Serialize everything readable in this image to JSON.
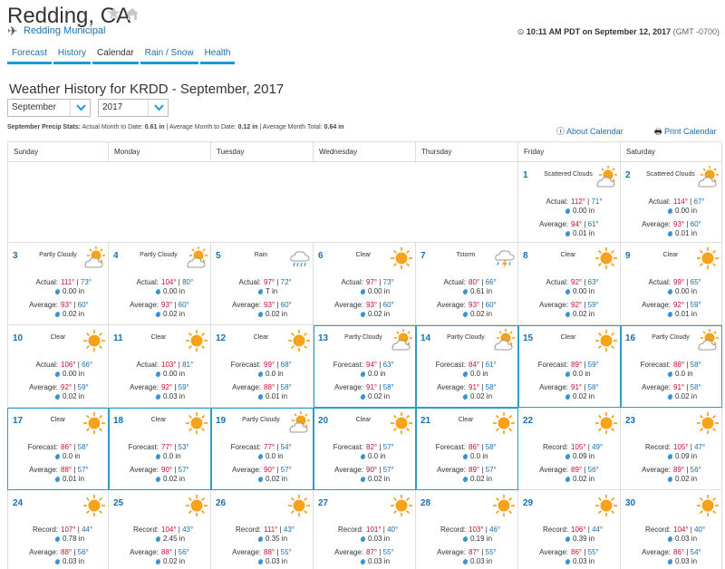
{
  "header": {
    "city": "Redding, CA",
    "station": "Redding Municipal",
    "time": "10:11 AM PDT on September 12, 2017",
    "tz": "(GMT -0700)"
  },
  "tabs": [
    "Forecast",
    "History",
    "Calendar",
    "Rain / Snow",
    "Health"
  ],
  "title": "Weather History for KRDD - September, 2017",
  "month_select": "September",
  "year_select": "2017",
  "stats": {
    "label": "September Precip Stats:",
    "actual_label": "Actual Month to Date:",
    "actual": "0.61 in",
    "avg_label": "Average Month to Date:",
    "avg": "0.12 in",
    "total_label": "Average Month Total:",
    "total": "0.64 in"
  },
  "links": {
    "about": "About Calendar",
    "print": "Print Calendar"
  },
  "days": [
    "Sunday",
    "Monday",
    "Tuesday",
    "Wednesday",
    "Thursday",
    "Friday",
    "Saturday"
  ],
  "colors": {
    "accent": "#1a9ad6",
    "link": "#1a6fb0",
    "high": "#c8102e",
    "highlight": "#2e9bc9"
  },
  "cells": [
    {
      "day": "1",
      "cond": "Scattered Clouds",
      "icon": "partly-cloudy-icon",
      "type": "Actual:",
      "hi": "112°",
      "lo": "71°",
      "precip": "0.00 in",
      "avg_hi": "94°",
      "avg_lo": "61°",
      "avg_precip": "0.01 in"
    },
    {
      "day": "2",
      "cond": "Scattered Clouds",
      "icon": "partly-cloudy-icon",
      "type": "Actual:",
      "hi": "114°",
      "lo": "67°",
      "precip": "0.00 in",
      "avg_hi": "93°",
      "avg_lo": "60°",
      "avg_precip": "0.01 in"
    },
    {
      "day": "3",
      "cond": "Partly Cloudy",
      "icon": "partly-cloudy-icon",
      "type": "Actual:",
      "hi": "111°",
      "lo": "73°",
      "precip": "0.00 in",
      "avg_hi": "93°",
      "avg_lo": "60°",
      "avg_precip": "0.02 in"
    },
    {
      "day": "4",
      "cond": "Partly Cloudy",
      "icon": "partly-cloudy-icon",
      "type": "Actual:",
      "hi": "104°",
      "lo": "80°",
      "precip": "0.00 in",
      "avg_hi": "93°",
      "avg_lo": "60°",
      "avg_precip": "0.02 in"
    },
    {
      "day": "5",
      "cond": "Rain",
      "icon": "rain-icon",
      "type": "Actual:",
      "hi": "97°",
      "lo": "72°",
      "precip": "T in",
      "avg_hi": "93°",
      "avg_lo": "60°",
      "avg_precip": "0.02 in"
    },
    {
      "day": "6",
      "cond": "Clear",
      "icon": "sun-icon",
      "type": "Actual:",
      "hi": "97°",
      "lo": "73°",
      "precip": "0.00 in",
      "avg_hi": "93°",
      "avg_lo": "60°",
      "avg_precip": "0.02 in"
    },
    {
      "day": "7",
      "cond": "Tstorm",
      "icon": "tstorm-icon",
      "type": "Actual:",
      "hi": "80°",
      "lo": "66°",
      "precip": "0.61 in",
      "avg_hi": "93°",
      "avg_lo": "60°",
      "avg_precip": "0.02 in"
    },
    {
      "day": "8",
      "cond": "Clear",
      "icon": "sun-icon",
      "type": "Actual:",
      "hi": "92°",
      "lo": "63°",
      "precip": "0.00 in",
      "avg_hi": "92°",
      "avg_lo": "59°",
      "avg_precip": "0.02 in"
    },
    {
      "day": "9",
      "cond": "Clear",
      "icon": "sun-icon",
      "type": "Actual:",
      "hi": "99°",
      "lo": "65°",
      "precip": "0.00 in",
      "avg_hi": "92°",
      "avg_lo": "59°",
      "avg_precip": "0.01 in"
    },
    {
      "day": "10",
      "cond": "Clear",
      "icon": "sun-icon",
      "type": "Actual:",
      "hi": "106°",
      "lo": "66°",
      "precip": "0.00 in",
      "avg_hi": "92°",
      "avg_lo": "59°",
      "avg_precip": "0.02 in"
    },
    {
      "day": "11",
      "cond": "Clear",
      "icon": "sun-icon",
      "type": "Actual:",
      "hi": "103°",
      "lo": "81°",
      "precip": "0.00 in",
      "avg_hi": "92°",
      "avg_lo": "59°",
      "avg_precip": "0.03 in"
    },
    {
      "day": "12",
      "cond": "Clear",
      "icon": "sun-icon",
      "type": "Forecast:",
      "hi": "99°",
      "lo": "68°",
      "precip": "0.0 in",
      "avg_hi": "88°",
      "avg_lo": "58°",
      "avg_precip": "0.01 in"
    },
    {
      "day": "13",
      "cond": "Partly Cloudy",
      "icon": "partly-cloudy-icon",
      "type": "Forecast:",
      "hi": "94°",
      "lo": "63°",
      "precip": "0.0 in",
      "avg_hi": "91°",
      "avg_lo": "58°",
      "avg_precip": "0.02 in"
    },
    {
      "day": "14",
      "cond": "Partly Cloudy",
      "icon": "partly-cloudy-icon",
      "type": "Forecast:",
      "hi": "84°",
      "lo": "61°",
      "precip": "0.0 in",
      "avg_hi": "91°",
      "avg_lo": "58°",
      "avg_precip": "0.02 in"
    },
    {
      "day": "15",
      "cond": "Clear",
      "icon": "sun-icon",
      "type": "Forecast:",
      "hi": "89°",
      "lo": "59°",
      "precip": "0.0 in",
      "avg_hi": "91°",
      "avg_lo": "58°",
      "avg_precip": "0.02 in"
    },
    {
      "day": "16",
      "cond": "Partly Cloudy",
      "icon": "partly-cloudy-icon",
      "type": "Forecast:",
      "hi": "88°",
      "lo": "58°",
      "precip": "0.0 in",
      "avg_hi": "91°",
      "avg_lo": "58°",
      "avg_precip": "0.02 in"
    },
    {
      "day": "17",
      "cond": "Clear",
      "icon": "sun-icon",
      "type": "Forecast:",
      "hi": "86°",
      "lo": "58°",
      "precip": "0.0 in",
      "avg_hi": "88°",
      "avg_lo": "57°",
      "avg_precip": "0.01 in"
    },
    {
      "day": "18",
      "cond": "Clear",
      "icon": "sun-icon",
      "type": "Forecast:",
      "hi": "77°",
      "lo": "53°",
      "precip": "0.0 in",
      "avg_hi": "90°",
      "avg_lo": "57°",
      "avg_precip": "0.02 in"
    },
    {
      "day": "19",
      "cond": "Partly Cloudy",
      "icon": "partly-cloudy-icon",
      "type": "Forecast:",
      "hi": "77°",
      "lo": "54°",
      "precip": "0.0 in",
      "avg_hi": "90°",
      "avg_lo": "57°",
      "avg_precip": "0.02 in"
    },
    {
      "day": "20",
      "cond": "Clear",
      "icon": "sun-icon",
      "type": "Forecast:",
      "hi": "82°",
      "lo": "57°",
      "precip": "0.0 in",
      "avg_hi": "90°",
      "avg_lo": "57°",
      "avg_precip": "0.02 in"
    },
    {
      "day": "21",
      "cond": "Clear",
      "icon": "sun-icon",
      "type": "Forecast:",
      "hi": "86°",
      "lo": "58°",
      "precip": "0.0 in",
      "avg_hi": "89°",
      "avg_lo": "57°",
      "avg_precip": "0.02 in"
    },
    {
      "day": "22",
      "cond": "",
      "icon": "sun-icon",
      "type": "Record:",
      "hi": "105°",
      "lo": "49°",
      "precip": "0.09 in",
      "avg_hi": "89°",
      "avg_lo": "56°",
      "avg_precip": "0.02 in"
    },
    {
      "day": "23",
      "cond": "",
      "icon": "sun-icon",
      "type": "Record:",
      "hi": "105°",
      "lo": "47°",
      "precip": "0.09 in",
      "avg_hi": "89°",
      "avg_lo": "56°",
      "avg_precip": "0.02 in"
    },
    {
      "day": "24",
      "cond": "",
      "icon": "sun-icon",
      "type": "Record:",
      "hi": "107°",
      "lo": "44°",
      "precip": "0.78 in",
      "avg_hi": "88°",
      "avg_lo": "56°",
      "avg_precip": "0.03 in"
    },
    {
      "day": "25",
      "cond": "",
      "icon": "sun-icon",
      "type": "Record:",
      "hi": "104°",
      "lo": "43°",
      "precip": "2.45 in",
      "avg_hi": "88°",
      "avg_lo": "56°",
      "avg_precip": "0.02 in"
    },
    {
      "day": "26",
      "cond": "",
      "icon": "sun-icon",
      "type": "Record:",
      "hi": "111°",
      "lo": "43°",
      "precip": "0.35 in",
      "avg_hi": "88°",
      "avg_lo": "55°",
      "avg_precip": "0.03 in"
    },
    {
      "day": "27",
      "cond": "",
      "icon": "sun-icon",
      "type": "Record:",
      "hi": "101°",
      "lo": "40°",
      "precip": "0.03 in",
      "avg_hi": "87°",
      "avg_lo": "55°",
      "avg_precip": "0.03 in"
    },
    {
      "day": "28",
      "cond": "",
      "icon": "sun-icon",
      "type": "Record:",
      "hi": "103°",
      "lo": "46°",
      "precip": "0.19 in",
      "avg_hi": "87°",
      "avg_lo": "55°",
      "avg_precip": "0.03 in"
    },
    {
      "day": "29",
      "cond": "",
      "icon": "sun-icon",
      "type": "Record:",
      "hi": "106°",
      "lo": "44°",
      "precip": "0.39 in",
      "avg_hi": "86°",
      "avg_lo": "55°",
      "avg_precip": "0.03 in"
    },
    {
      "day": "30",
      "cond": "",
      "icon": "sun-icon",
      "type": "Record:",
      "hi": "104°",
      "lo": "40°",
      "precip": "0.03 in",
      "avg_hi": "86°",
      "avg_lo": "54°",
      "avg_precip": "0.03 in"
    }
  ],
  "avg_label": "Average:"
}
